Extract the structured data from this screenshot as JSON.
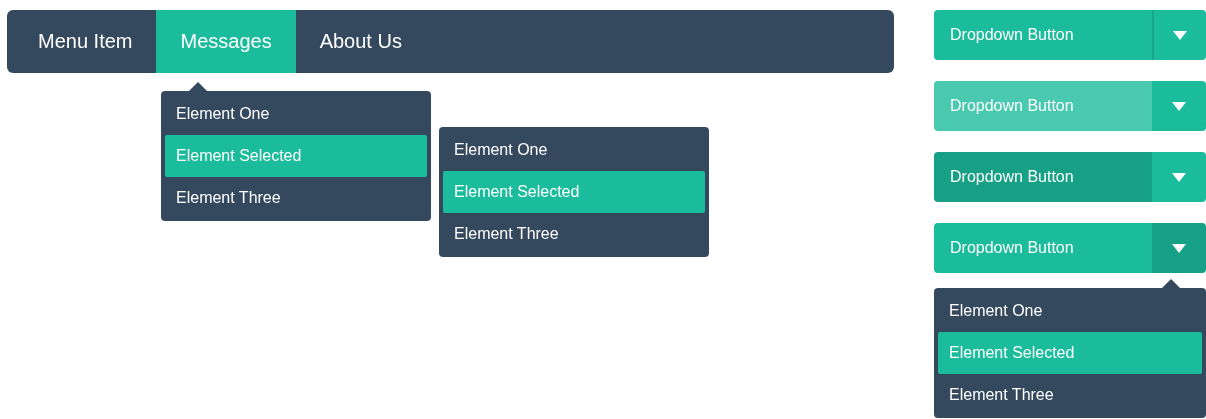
{
  "navbar": {
    "items": [
      {
        "label": "Menu Item",
        "selected": false
      },
      {
        "label": "Messages",
        "selected": true
      },
      {
        "label": "About Us",
        "selected": false
      }
    ],
    "menu": {
      "pointer": true,
      "items": [
        {
          "label": "Element One",
          "selected": false
        },
        {
          "label": "Element Selected",
          "selected": true
        },
        {
          "label": "Element Three",
          "selected": false
        }
      ]
    }
  },
  "submenu": {
    "items": [
      {
        "label": "Element One",
        "selected": false
      },
      {
        "label": "Element Selected",
        "selected": true
      },
      {
        "label": "Element Three",
        "selected": false
      }
    ]
  },
  "dropdown_buttons": [
    {
      "label": "Dropdown Button",
      "hover": false,
      "pressed": false,
      "open": false
    },
    {
      "label": "Dropdown Button",
      "hover": true,
      "pressed": false,
      "open": false
    },
    {
      "label": "Dropdown Button",
      "hover": false,
      "pressed": true,
      "open": false
    },
    {
      "label": "Dropdown Button",
      "hover": false,
      "pressed": false,
      "open": true
    }
  ],
  "button_menu": {
    "pointer": true,
    "items": [
      {
        "label": "Element One",
        "selected": false
      },
      {
        "label": "Element Selected",
        "selected": true
      },
      {
        "label": "Element Three",
        "selected": false
      }
    ]
  }
}
